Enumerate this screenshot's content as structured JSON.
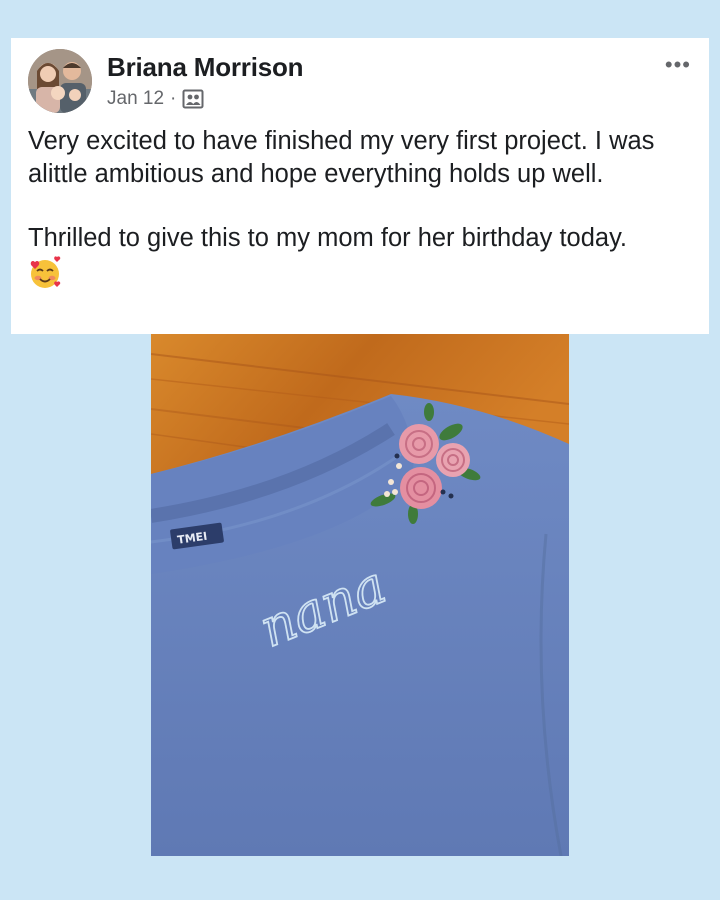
{
  "post": {
    "author": "Briana Morrison",
    "date": "Jan 12",
    "separator": "·",
    "audience_icon": "friends-audience-icon",
    "more_label": "•••",
    "paragraph_1": "Very excited to have finished my very first project. I was alittle ambitious and hope everything holds up well.",
    "paragraph_2": "Thrilled to give this to my mom for her birthday today.",
    "emoji": "smiling-face-with-hearts"
  },
  "photo": {
    "embroidered_text": "nana",
    "tag_text": "TMEI",
    "colors": {
      "sweatshirt": "#6b86c0",
      "wood": "#c9731f",
      "rose": "#e79aa9"
    }
  }
}
